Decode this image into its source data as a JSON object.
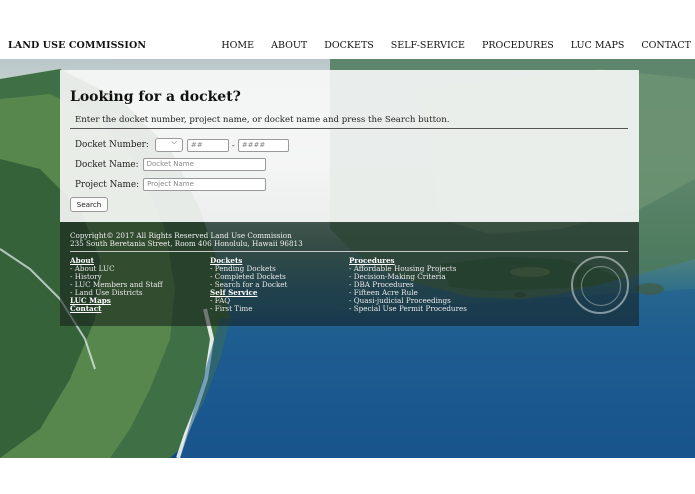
{
  "header": {
    "brand": "LAND USE COMMISSION",
    "nav": [
      "HOME",
      "ABOUT",
      "DOCKETS",
      "SELF-SERVICE",
      "PROCEDURES",
      "LUC MAPS",
      "CONTACT"
    ]
  },
  "search": {
    "title": "Looking for a docket?",
    "intro": "Enter the docket number, project name, or docket name and press the Search button.",
    "docket_number_label": "Docket Number:",
    "docket_number_select_value": "",
    "docket_number_part1_placeholder": "##",
    "docket_number_part2_placeholder": "####",
    "docket_number_separator": "-",
    "docket_name_label": "Docket Name:",
    "docket_name_placeholder": "Docket Name",
    "project_name_label": "Project Name:",
    "project_name_placeholder": "Project Name",
    "search_button": "Search"
  },
  "footer": {
    "copyright": "Copyright© 2017 All Rights Reserved Land Use Commission",
    "address": "235 South Beretania Street, Room 406 Honolulu, Hawaii 96813",
    "col1": {
      "heading": "About",
      "items": [
        "- About LUC",
        "- History",
        "- LUC Members and Staff",
        "- Land Use Districts"
      ],
      "links": [
        "LUC Maps",
        "Contact"
      ]
    },
    "col2": {
      "heading": "Dockets",
      "items": [
        "- Pending Dockets",
        "- Completed Dockets",
        "- Search for a Docket"
      ],
      "heading2": "Self Service",
      "items2": [
        "- FAQ",
        "- First Time"
      ]
    },
    "col3": {
      "heading": "Procedures",
      "items": [
        "- Affordable Housing Projects",
        "- Decision-Making Criteria",
        "- DBA Procedures",
        "- Fifteen Acre Rule",
        "- Quasi-judicial Proceedings",
        "- Special Use Permit Procedures"
      ]
    }
  },
  "colors": {
    "panel_bg": "#f8f8f8",
    "footer_bg": "#141c1a",
    "text": "#111111"
  }
}
